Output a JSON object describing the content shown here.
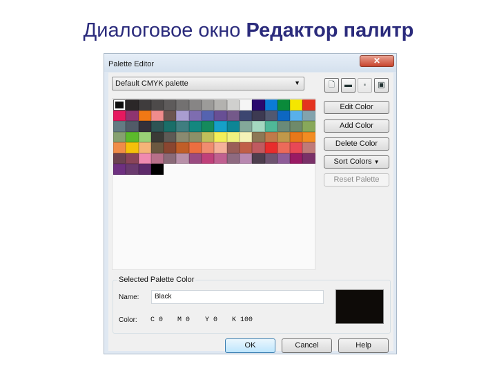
{
  "heading": {
    "normal": "Диалоговое окно",
    "bold": "Редактор палитр"
  },
  "dialog": {
    "title": "Palette Editor",
    "close_icon": "close-icon",
    "palette_select": "Default CMYK palette",
    "toolbar": [
      {
        "icon": "new-palette-icon"
      },
      {
        "icon": "open-palette-icon"
      },
      {
        "icon": "save-palette-icon",
        "disabled": true
      },
      {
        "icon": "save-as-palette-icon"
      }
    ],
    "colors": [
      "#0d0d0d",
      "#2b2728",
      "#3f3c3d",
      "#4d4a4a",
      "#5e5b5b",
      "#737171",
      "#878585",
      "#9c9b99",
      "#b3b2af",
      "#d0d0ce",
      "#f5f5f5",
      "#2a0a6e",
      "#0b7bd6",
      "#0a8a3a",
      "#f4e600",
      "#e4321e",
      "#e6185f",
      "#8e3470",
      "#f07815",
      "#f08c8c",
      "#6b5550",
      "#a99dd0",
      "#7e6db0",
      "#5563b0",
      "#684f95",
      "#74598a",
      "#3c4670",
      "#3d3a52",
      "#515870",
      "#0d67c2",
      "#58b0ea",
      "#82a3ad",
      "#637b83",
      "#515b68",
      "#34303a",
      "#2e5454",
      "#1a6e68",
      "#3f7e80",
      "#14877f",
      "#158a5c",
      "#16a0c8",
      "#0e8595",
      "#83a89a",
      "#a4d8c0",
      "#4fb898",
      "#6a8a78",
      "#6f8a6a",
      "#88a85a",
      "#86a070",
      "#5cba2c",
      "#9ad076",
      "#3a3a36",
      "#5e5a55",
      "#8a8a70",
      "#8c9068",
      "#c0c05a",
      "#f2ef5a",
      "#f0f280",
      "#f5f2b8",
      "#8d7855",
      "#c07a4a",
      "#c0984a",
      "#e8781a",
      "#f28c22",
      "#f08c48",
      "#f5c00a",
      "#f5b478",
      "#6b5840",
      "#8a4630",
      "#c05e28",
      "#ec6e40",
      "#f08c70",
      "#f5b09a",
      "#9a5d58",
      "#c05e48",
      "#c05a60",
      "#e82c2c",
      "#ec6a5a",
      "#e84856",
      "#c07a78",
      "#6b4250",
      "#8a4458",
      "#f08ab0",
      "#b8708a",
      "#8a6a78",
      "#b890a8",
      "#9a4a80",
      "#c0407a",
      "#c06090",
      "#8e6a80",
      "#b888b0",
      "#4e3e4e",
      "#6e5470",
      "#8e5c98",
      "#9a1a64",
      "#7a3068",
      "#6e3080",
      "#6a3a6e",
      "#5e2a6a",
      "#000000"
    ],
    "buttons": {
      "edit": "Edit Color",
      "add": "Add Color",
      "delete": "Delete Color",
      "sort": "Sort Colors",
      "reset": "Reset Palette"
    },
    "selected": {
      "group_label": "Selected Palette Color",
      "name_label": "Name:",
      "name_value": "Black",
      "color_label": "Color:",
      "c": "C 0",
      "m": "M 0",
      "y": "Y 0",
      "k": "K 100",
      "swatch_color": "#0e0b08"
    },
    "footer": {
      "ok": "OK",
      "cancel": "Cancel",
      "help": "Help"
    }
  }
}
